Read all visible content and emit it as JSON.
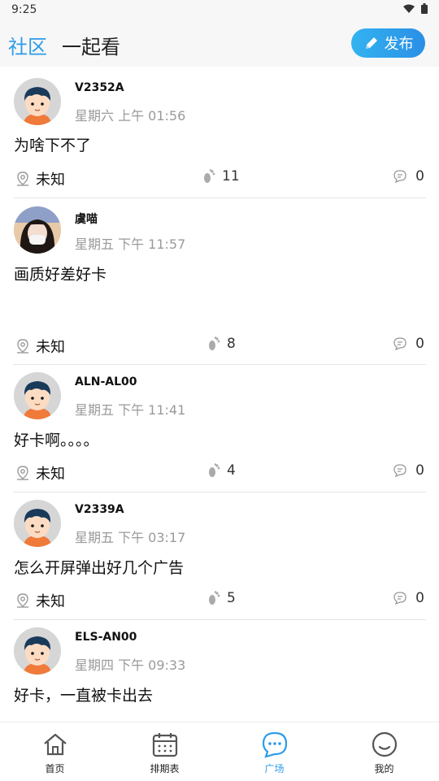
{
  "status_bar": {
    "time": "9:25"
  },
  "header": {
    "tab_active": "社区",
    "tab_inactive": "一起看",
    "publish_label": "发布"
  },
  "posts": [
    {
      "username": "V2352A",
      "time": "星期六 上午 01:56",
      "content": "为啥下不了",
      "location": "未知",
      "views": "11",
      "comments": "0",
      "avatar": "cartoon"
    },
    {
      "username": "虞喵",
      "time": "星期五 下午 11:57",
      "content": "画质好差好卡",
      "location": "未知",
      "views": "8",
      "comments": "0",
      "avatar": "photo"
    },
    {
      "username": "ALN-AL00",
      "time": "星期五 下午 11:41",
      "content": "好卡啊。。。。",
      "location": "未知",
      "views": "4",
      "comments": "0",
      "avatar": "cartoon"
    },
    {
      "username": "V2339A",
      "time": "星期五 下午 03:17",
      "content": "怎么开屏弹出好几个广告",
      "location": "未知",
      "views": "5",
      "comments": "0",
      "avatar": "cartoon"
    },
    {
      "username": "ELS-AN00",
      "time": "星期四 下午 09:33",
      "content": "好卡，一直被卡出去",
      "location": "",
      "views": "",
      "comments": "",
      "avatar": "cartoon"
    }
  ],
  "bottom_nav": [
    {
      "label": "首页",
      "icon": "home-icon"
    },
    {
      "label": "排期表",
      "icon": "calendar-icon"
    },
    {
      "label": "广场",
      "icon": "chat-bubble-icon"
    },
    {
      "label": "我的",
      "icon": "smiley-icon"
    }
  ],
  "colors": {
    "accent": "#2c9be8",
    "text": "#111111",
    "muted": "#9a9a9a"
  }
}
